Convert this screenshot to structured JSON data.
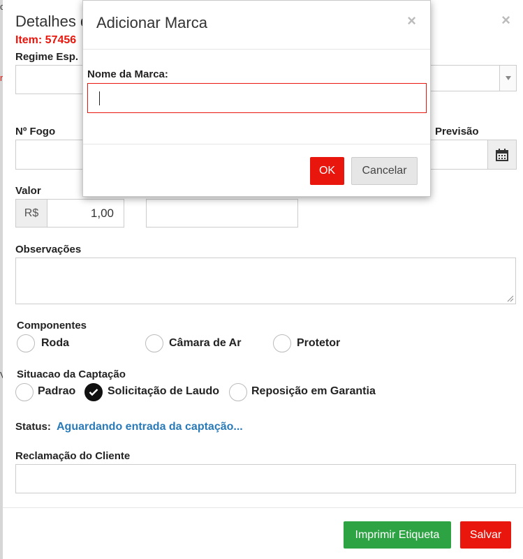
{
  "edge": {
    "chars": [
      "c",
      "r",
      "V"
    ]
  },
  "modal": {
    "title": "Detalhes d",
    "close_glyph": "×",
    "item_label": "Item: 57456",
    "labels": {
      "regime": "Regime Esp.",
      "fogo": "Nº Fogo",
      "previsao": "Previsão",
      "valor": "Valor",
      "observacoes": "Observações",
      "componentes": "Componentes",
      "situacao": "Situacao da Captação",
      "reclamacao": "Reclamação do Cliente"
    },
    "currency": "R$",
    "valor_value": "1,00",
    "componentes": [
      {
        "label": "Roda",
        "checked": false
      },
      {
        "label": "Câmara de Ar",
        "checked": false
      },
      {
        "label": "Protetor",
        "checked": false
      }
    ],
    "situacao": [
      {
        "label": "Padrao",
        "checked": false
      },
      {
        "label": "Solicitação de Laudo",
        "checked": true
      },
      {
        "label": "Reposição em Garantia",
        "checked": false
      }
    ],
    "status_label": "Status:",
    "status_value": "Aguardando entrada da captação...",
    "buttons": {
      "print": "Imprimir Etiqueta",
      "save": "Salvar"
    },
    "colors": {
      "accent_red": "#e8160c",
      "green": "#2ea344",
      "status_blue": "#2a7ab8"
    }
  },
  "dialog": {
    "title": "Adicionar Marca",
    "close_glyph": "×",
    "field_label": "Nome da Marca:",
    "field_value": "",
    "ok": "OK",
    "cancel": "Cancelar"
  }
}
